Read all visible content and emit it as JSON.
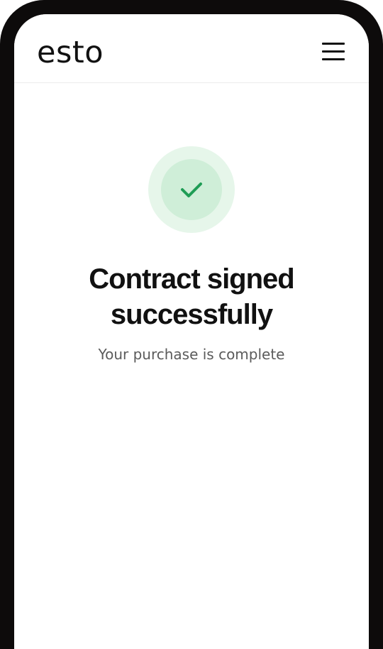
{
  "header": {
    "logo_text": "esto",
    "menu_icon": "hamburger-menu-icon"
  },
  "success": {
    "icon": "checkmark-icon",
    "title_line1": "Contract signed",
    "title_line2": "successfully",
    "subtitle": "Your purchase is complete"
  },
  "colors": {
    "badge_outer": "#e6f6ea",
    "badge_inner": "#cfeed8",
    "check": "#1f9d55",
    "text_primary": "#111111",
    "text_secondary": "#5b5b5b",
    "frame": "#0d0b0b"
  }
}
